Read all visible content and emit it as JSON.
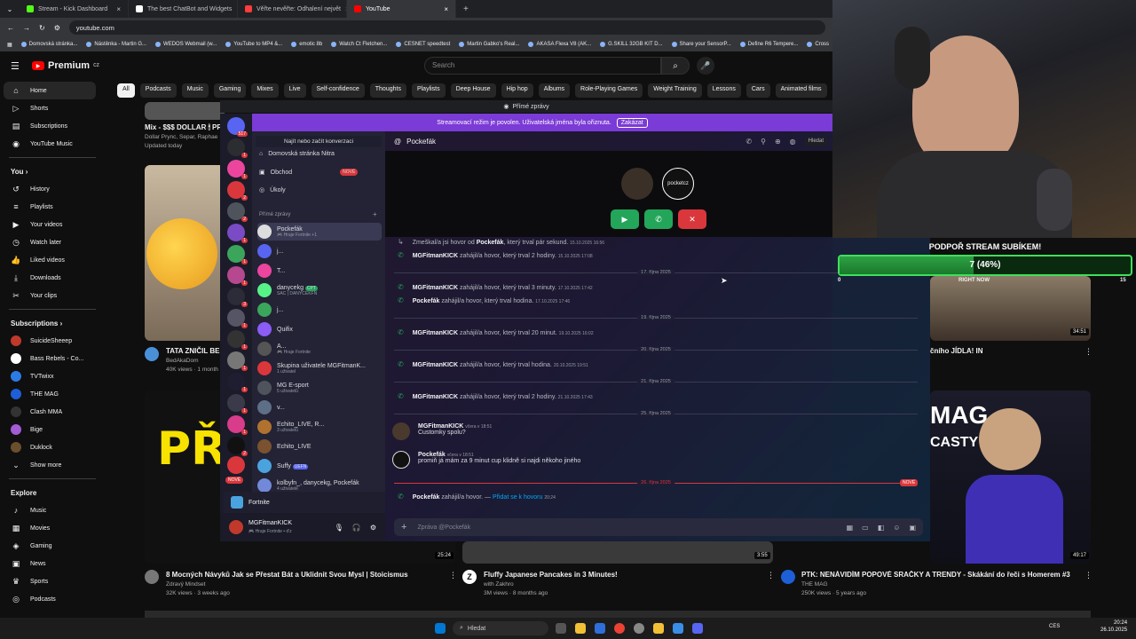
{
  "browser": {
    "tabs": [
      {
        "label": "Stream - Kick Dashboard",
        "color": "#53fc18"
      },
      {
        "label": "The best ChatBot and Widgets",
        "color": "#ffffff"
      },
      {
        "label": "Věřte nevěřte: Odhalení největ",
        "color": "#ff3b3b"
      },
      {
        "label": "YouTube",
        "color": "#ff0000"
      }
    ],
    "url": "youtube.com",
    "bookmarks": [
      "Domovská stránka...",
      "Nástěnka - Martin G...",
      "WEDOS Webmail (w...",
      "YouTube to MP4 &...",
      "emotic 8b",
      "Watch Ct Fletchen...",
      "CESNET speedtest",
      "Martin Gabko's Real...",
      "AKASA Flexa V8 (AK...",
      "G.SKILL 32GB KIT D...",
      "Share your SensorP...",
      "Define R6 Tempere...",
      "Cross"
    ]
  },
  "youtube": {
    "logo": "Premium",
    "logo_sup": "CZ",
    "search_placeholder": "Search",
    "chips": [
      "All",
      "Podcasts",
      "Music",
      "Gaming",
      "Mixes",
      "Live",
      "Self-confidence",
      "Thoughts",
      "Playlists",
      "Deep House",
      "Hip hop",
      "Albums",
      "Role-Playing Games",
      "Weight Training",
      "Lessons",
      "Cars",
      "Animated films"
    ],
    "nav_main": [
      "Home",
      "Shorts",
      "Subscriptions",
      "YouTube Music"
    ],
    "you_header": "You",
    "nav_you": [
      "History",
      "Playlists",
      "Your videos",
      "Watch later",
      "Liked videos",
      "Downloads",
      "Your clips"
    ],
    "subs_header": "Subscriptions",
    "subs": [
      {
        "name": "SuicideSheeep",
        "color": "#c0392b"
      },
      {
        "name": "Bass Rebels - Co...",
        "color": "#ffffff"
      },
      {
        "name": "TVTwixx",
        "color": "#2c7be5"
      },
      {
        "name": "THE MAG",
        "color": "#1e5fd8"
      },
      {
        "name": "Clash MMA",
        "color": "#333333"
      },
      {
        "name": "Bige",
        "color": "#a25cd6"
      },
      {
        "name": "Duklock",
        "color": "#6b4e2e"
      }
    ],
    "show_more": "Show more",
    "explore_header": "Explore",
    "nav_explore": [
      "Music",
      "Movies",
      "Gaming",
      "News",
      "Sports",
      "Podcasts"
    ],
    "videos": {
      "mix_title": "Mix - $$$ DOLLAR 🕯 PR",
      "mix_meta1": "Dollar Prync, Separ, Raphae",
      "mix_meta2": "Updated today",
      "v2_title": "TATA ZNIČIL BED",
      "v2_channel": "BedAkaDom",
      "v2_meta": "40K views · 1 month",
      "v3_partial": "čního JÍDLA! IN",
      "v3_duration": "34:51",
      "thumb_text": "PŘES",
      "mag_text": "MAG",
      "casty_text": "CASTY",
      "b1_title": "8 Mocných Návyků Jak se Přestat Bát a Uklidnit Svou Mysl | Stoicismus",
      "b1_channel": "Zdravý Mindset",
      "b1_meta": "32K views · 3 weeks ago",
      "b1_duration": "25:24",
      "b2_title": "Fluffy Japanese Pancakes in 3 Minutes!",
      "b2_channel": "with Zakhro",
      "b2_meta": "3M views · 8 months ago",
      "b2_duration": "3:55",
      "b3_title": "PTK: NENÁVIDÍM POPOVÉ SRAČKY A TRENDY - Skákání do řeči s Homerem #3",
      "b3_channel": "THE MAG",
      "b3_meta": "250K views · 5 years ago",
      "b3_duration": "49:17"
    }
  },
  "discord": {
    "banner": "Přímé zprávy",
    "stream_notice": "Streamovací režim je povolen. Uživatelská jména byla ořiznuta.",
    "stream_btn": "Zakázat",
    "server_badges": [
      "517",
      "1",
      "1",
      "2",
      "2",
      "1",
      "1",
      "1",
      "3",
      "1",
      "1",
      "1",
      "1",
      "1",
      "1",
      "2",
      "4",
      "1",
      "1",
      "1",
      "1",
      "1"
    ],
    "nove_badge": "NOVÉ",
    "find": "Najít nebo začít konverzaci",
    "nav": [
      "Domovská stránka Nitra",
      "Obchod",
      "Úkoly"
    ],
    "nav_badge": "NOVÉ",
    "dm_header": "Přímé zprávy",
    "dms": [
      {
        "name": "Pockefák",
        "sub": "🎮 Hraje Fortnite +1",
        "color": "#dddddd"
      },
      {
        "name": "j...",
        "sub": "",
        "color": "#5865f2"
      },
      {
        "name": "T...",
        "sub": "",
        "color": "#eb459e"
      },
      {
        "name": "danycekg",
        "tag": "CPT",
        "sub": "SAC | DANYCEKFN",
        "color": "#57f287"
      },
      {
        "name": "j...",
        "sub": "",
        "color": "#3ba55c"
      },
      {
        "name": "Quifix",
        "sub": "",
        "color": "#8b5cf6"
      },
      {
        "name": "A...",
        "sub": "🎮 Hraje Fortnite",
        "color": "#2b2d31"
      },
      {
        "name": "Skupina uživatele MGFitmanK...",
        "sub": "1 uživatel",
        "color": "#da373c"
      },
      {
        "name": "MG E-sport",
        "sub": "5 uživatelů",
        "color": "#4f545c"
      },
      {
        "name": "v...",
        "sub": "",
        "color": "#5c6f86"
      },
      {
        "name": "Echito_LIVE, R...",
        "sub": "3 uživatelů",
        "color": "#b0722e"
      },
      {
        "name": "Echito_LIVE",
        "sub": "",
        "color": "#7a5230"
      },
      {
        "name": "Suffy",
        "tag": "UEFN",
        "sub": "",
        "color": "#4aa3df"
      },
      {
        "name": "kolbyfn_, danycekg, Pockefák",
        "sub": "4 uživatelé",
        "color": "#7289da"
      }
    ],
    "active_activity": "Fortnite",
    "user": {
      "name": "MGFitmanKICK",
      "status": "🎮 Hraje Fortnite • d'z"
    },
    "channel": "Pockefák",
    "search_stub": "Hledat",
    "call_avatar_label": "pocketcz",
    "messages": [
      {
        "type": "call",
        "text": "Zmeškal/a jsi hovor od ",
        "bold": "Pockefák",
        "rest": ", který trval pár sekund.",
        "ts": "15.10.2025 16:56",
        "missed": true
      },
      {
        "type": "call",
        "bold": "MGFitmanKICK",
        "rest": " zahájil/a hovor, který trval 2 hodiny.",
        "ts": "15.10.2025 17:08"
      },
      {
        "type": "date",
        "text": "17. října 2025"
      },
      {
        "type": "call",
        "bold": "MGFitmanKICK",
        "rest": " zahájil/a hovor, který trval 3 minuty.",
        "ts": "17.10.2025 17:42"
      },
      {
        "type": "call",
        "bold": "Pockefák",
        "rest": " zahájil/a hovor, který trval hodina.",
        "ts": "17.10.2025 17:46"
      },
      {
        "type": "date",
        "text": "19. října 2025"
      },
      {
        "type": "call",
        "bold": "MGFitmanKICK",
        "rest": " zahájil/a hovor, který trval 20 minut.",
        "ts": "19.10.2025 16:02"
      },
      {
        "type": "date",
        "text": "20. října 2025"
      },
      {
        "type": "call",
        "bold": "MGFitmanKICK",
        "rest": " zahájil/a hovor, který trval hodina.",
        "ts": "20.10.2025 19:51"
      },
      {
        "type": "date",
        "text": "21. října 2025"
      },
      {
        "type": "call",
        "bold": "MGFitmanKICK",
        "rest": " zahájil/a hovor, který trval 2 hodiny.",
        "ts": "21.10.2025 17:43"
      },
      {
        "type": "date",
        "text": "25. října 2025"
      },
      {
        "type": "chat",
        "author": "MGFitmanKICK",
        "ts": "včera v 18:51",
        "text": "Customky spolu?"
      },
      {
        "type": "chat",
        "author": "Pockefák",
        "ts": "včera v 18:51",
        "text": "promiň já mám za 9 minut cup klidně si najdi někoho jiného"
      },
      {
        "type": "date",
        "text": "26. října 2025",
        "new": "NOVÉ"
      },
      {
        "type": "call",
        "bold": "Pockefák",
        "rest": " zahájil/a hovor. — ",
        "link": "Přidat se k hovoru",
        "ts": "20:24"
      }
    ],
    "input_placeholder": "Zpráva @Pockefák"
  },
  "stream_overlay": {
    "sub_goal_title": "PODPOŘ STREAM SUBÍKEM!",
    "sub_goal_text": "7 (46%)",
    "sub_goal_fraction": 0.46,
    "sub_goal_min": "0",
    "sub_goal_max": "15",
    "sub_goal_sub": "RIGHT NOW"
  },
  "taskbar": {
    "search": "Hledat",
    "lang": "CES",
    "time": "20:24",
    "date": "26.10.2025"
  }
}
